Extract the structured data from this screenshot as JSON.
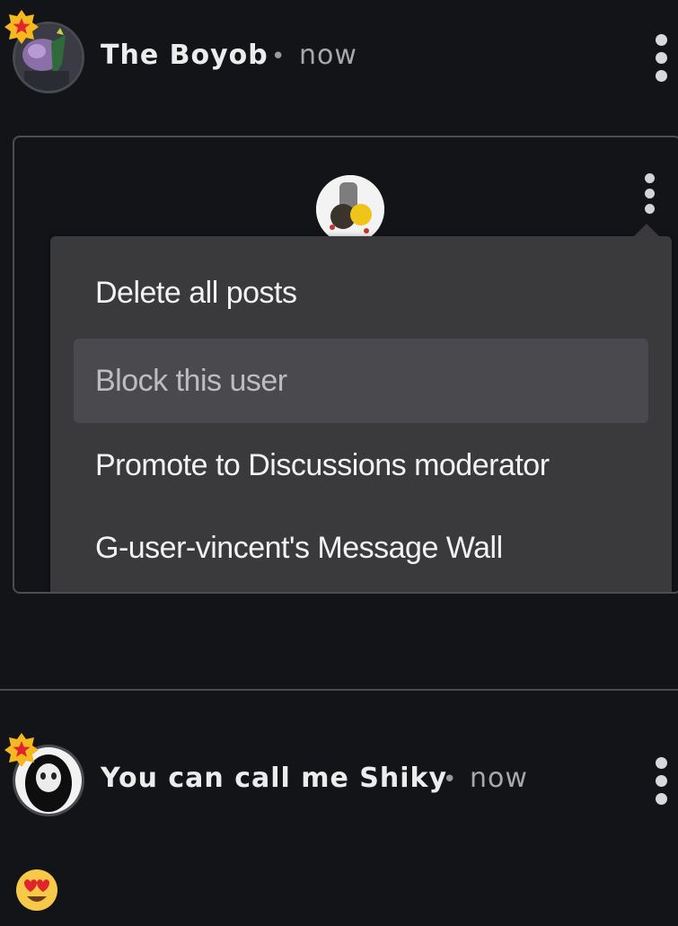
{
  "posts": [
    {
      "author": "The Boyob",
      "separator": "•",
      "timestamp": "now",
      "avatar": "purple-creature-avatar",
      "badge": "star-badge-icon",
      "menu_icon": "kebab-menu-icon"
    },
    {
      "author": "You can call me Shiky",
      "separator": "•",
      "timestamp": "now",
      "avatar": "pale-face-avatar",
      "badge": "star-badge-icon",
      "menu_icon": "kebab-menu-icon",
      "content_emoji": "heart-eyes-emoji"
    }
  ],
  "embed": {
    "avatar": "user-avatar",
    "menu_icon": "kebab-menu-icon",
    "menu_items": [
      "Delete all posts",
      "Block this user",
      "Promote to Discussions moderator",
      "G-user-vincent's Message Wall"
    ],
    "highlighted_item": "Block this user"
  },
  "colors": {
    "background": "#131418",
    "menu_background": "#3a3a3d",
    "menu_highlight": "#4a4a4e",
    "badge": "#f5b81f",
    "badge_star": "#e0242e"
  }
}
